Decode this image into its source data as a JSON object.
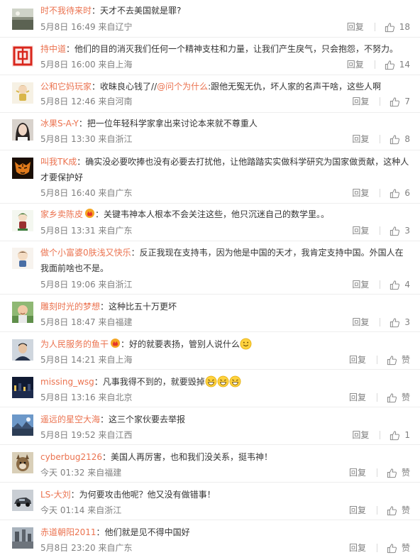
{
  "comments": [
    {
      "user": "时不我待来时",
      "sep": "：",
      "text": "天才不去美国就是罪?",
      "date": "5月8日 16:49",
      "location": "来自辽宁",
      "reply": "回复",
      "likes": "18",
      "avatar": "dark-landscape"
    },
    {
      "user": "持中道",
      "sep": "：",
      "text": "他们的目的消灭我们任何一个精神支柱和力量，让我们产生戾气，只会抱怨，不努力。",
      "date": "5月8日 16:00",
      "location": "来自上海",
      "reply": "回复",
      "likes": "14",
      "avatar": "red-zhong"
    },
    {
      "user": "公和它妈玩家",
      "sep": "：",
      "text_before": "收昧良心钱了//",
      "mention": "@问个为什么",
      "text_after": ":跟他无冤无仇，坏人家的名声干啥，这些人啊",
      "date": "5月8日 12:46",
      "location": "来自河南",
      "reply": "回复",
      "likes": "7",
      "avatar": "cartoon-doll"
    },
    {
      "user": "冰果S-A-Y",
      "sep": "：",
      "text": "把一位年轻科学家拿出来讨论本来就不尊重人",
      "date": "5月8日 13:30",
      "location": "来自浙江",
      "reply": "回复",
      "likes": "8",
      "avatar": "girl-portrait"
    },
    {
      "user": "叫我TK成",
      "sep": "：",
      "text": "确实没必要吹捧也没有必要去打扰他，让他踏踏实实做科学研究为国家做贡献，这种人才要保护好",
      "date": "5月8日 16:40",
      "location": "来自广东",
      "reply": "回复",
      "likes": "6",
      "avatar": "tiger"
    },
    {
      "user": "家乡卖陈皮",
      "sep": "：",
      "text": "关键韦神本人根本不会关注这些，他只沉迷自己的数学里。。",
      "date": "5月8日 13:31",
      "location": "来自广东",
      "reply": "回复",
      "likes": "3",
      "avatar": "cartoon-green"
    },
    {
      "user": "做个小富婆0肤浅又快乐",
      "sep": "：",
      "text": "反正我现在支持韦，因为他是中国的天才，我肯定支持中国。外国人在我面前啥也不是。",
      "date": "5月8日 19:06",
      "location": "来自浙江",
      "reply": "回复",
      "likes": "4",
      "avatar": "cartoon-boy"
    },
    {
      "user": "雕刻时光的梦想",
      "sep": "：",
      "text": "这种比五十万更坏",
      "date": "5月8日 18:47",
      "location": "来自福建",
      "reply": "回复",
      "likes": "3",
      "avatar": "baby-photo"
    },
    {
      "user": "为人民服务的鱼干",
      "sep": "：",
      "text": "好的就要表扬，管别人说什么",
      "date": "5月8日 14:21",
      "location": "来自上海",
      "reply": "回复",
      "likes": "赞",
      "avatar": "man-portrait"
    },
    {
      "user": "missing_wsg",
      "sep": "：",
      "text": "凡事我得不到的，就要毁掉",
      "date": "5月8日 13:16",
      "location": "来自北京",
      "reply": "回复",
      "likes": "赞",
      "avatar": "night-city"
    },
    {
      "user": "遥远的星空大海",
      "sep": "：",
      "text": "这三个家伙要去举报",
      "date": "5月8日 19:52",
      "location": "来自江西",
      "reply": "回复",
      "likes": "1",
      "avatar": "sky-scene"
    },
    {
      "user": "cyberbug2126",
      "sep": "：",
      "text": "美国人再厉害，也和我们没关系，挺韦神！",
      "date": "今天 01:32",
      "location": "来自福建",
      "reply": "回复",
      "likes": "赞",
      "avatar": "dog"
    },
    {
      "user": "LS-大刘",
      "sep": "：",
      "text": "为何要攻击他呢？他又没有做错事！",
      "date": "今天 01:14",
      "location": "来自浙江",
      "reply": "回复",
      "likes": "赞",
      "avatar": "car"
    },
    {
      "user": "赤道朝阳2011",
      "sep": "：",
      "text": "他们就是见不得中国好",
      "date": "5月8日 23:20",
      "location": "来自广东",
      "reply": "回复",
      "likes": "赞",
      "avatar": "street"
    }
  ]
}
